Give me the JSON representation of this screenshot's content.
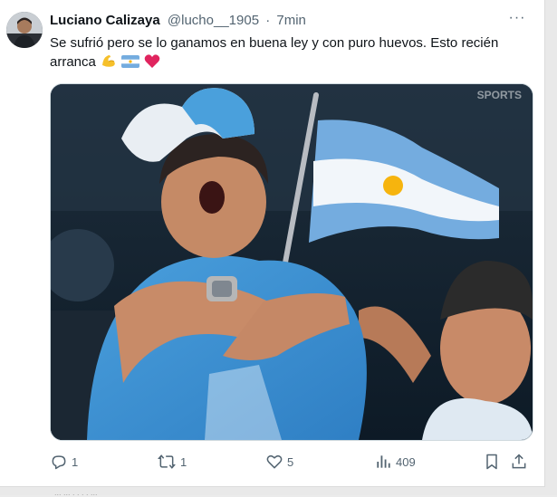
{
  "tweet": {
    "author_name": "Luciano Calizaya",
    "author_handle": "@lucho__1905",
    "separator": "·",
    "time": "7min",
    "more_label": "···",
    "text_line1": "Se sufrió pero se lo ganamos en buena ley y con puro huevos. Esto recién",
    "text_line2": "arranca",
    "emojis": [
      "flexed-biceps",
      "argentina-flag",
      "red-heart"
    ]
  },
  "media": {
    "watermark": "SPORTS",
    "description_icon": "photo"
  },
  "actions": {
    "reply_count": "1",
    "retweet_count": "1",
    "like_count": "5",
    "views_count": "409"
  },
  "footer": {
    "partial_text": "... ... . . . . ..."
  },
  "colors": {
    "text_primary": "#0f1419",
    "text_secondary": "#536471",
    "heart": "#e0245e",
    "argentina_blue": "#74acdf"
  }
}
